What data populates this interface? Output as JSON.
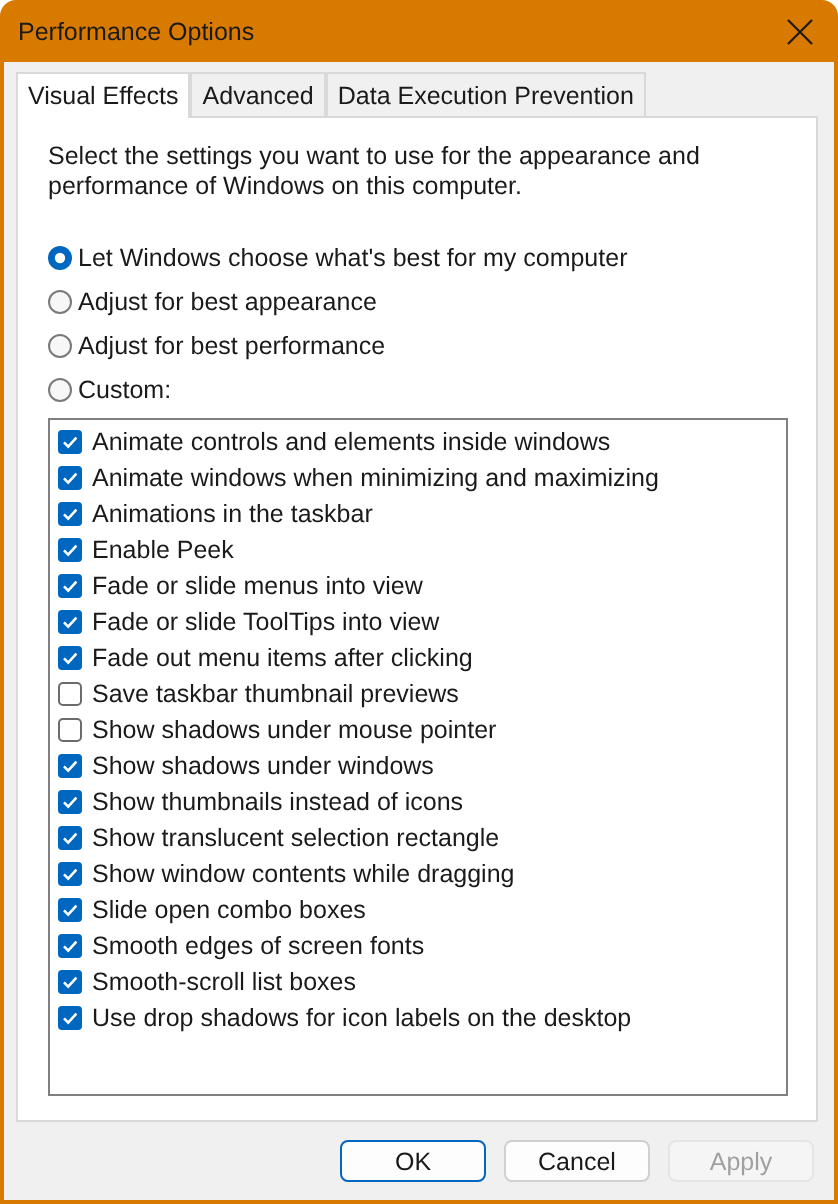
{
  "window": {
    "title": "Performance Options"
  },
  "tabs": [
    {
      "label": "Visual Effects",
      "selected": true
    },
    {
      "label": "Advanced",
      "selected": false
    },
    {
      "label": "Data Execution Prevention",
      "selected": false
    }
  ],
  "description": "Select the settings you want to use for the appearance and performance of Windows on this computer.",
  "options": [
    {
      "label": "Let Windows choose what's best for my computer",
      "selected": true
    },
    {
      "label": "Adjust for best appearance",
      "selected": false
    },
    {
      "label": "Adjust for best performance",
      "selected": false
    },
    {
      "label": "Custom:",
      "selected": false
    }
  ],
  "effects": [
    {
      "label": "Animate controls and elements inside windows",
      "checked": true
    },
    {
      "label": "Animate windows when minimizing and maximizing",
      "checked": true
    },
    {
      "label": "Animations in the taskbar",
      "checked": true
    },
    {
      "label": "Enable Peek",
      "checked": true
    },
    {
      "label": "Fade or slide menus into view",
      "checked": true
    },
    {
      "label": "Fade or slide ToolTips into view",
      "checked": true
    },
    {
      "label": "Fade out menu items after clicking",
      "checked": true
    },
    {
      "label": "Save taskbar thumbnail previews",
      "checked": false
    },
    {
      "label": "Show shadows under mouse pointer",
      "checked": false
    },
    {
      "label": "Show shadows under windows",
      "checked": true
    },
    {
      "label": "Show thumbnails instead of icons",
      "checked": true
    },
    {
      "label": "Show translucent selection rectangle",
      "checked": true
    },
    {
      "label": "Show window contents while dragging",
      "checked": true
    },
    {
      "label": "Slide open combo boxes",
      "checked": true
    },
    {
      "label": "Smooth edges of screen fonts",
      "checked": true
    },
    {
      "label": "Smooth-scroll list boxes",
      "checked": true
    },
    {
      "label": "Use drop shadows for icon labels on the desktop",
      "checked": true
    }
  ],
  "buttons": [
    {
      "label": "OK",
      "kind": "default",
      "disabled": false
    },
    {
      "label": "Cancel",
      "kind": "normal",
      "disabled": false
    },
    {
      "label": "Apply",
      "kind": "normal",
      "disabled": true
    }
  ]
}
